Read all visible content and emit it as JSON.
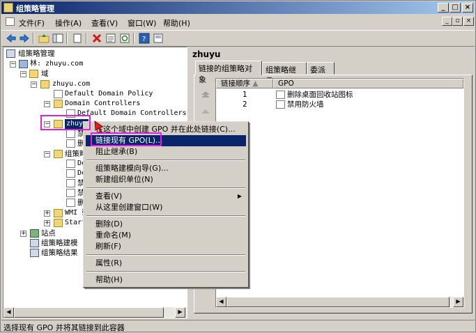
{
  "window": {
    "title": "组策略管理",
    "controls": [
      "_",
      "□",
      "×"
    ]
  },
  "menubar": {
    "items": [
      {
        "label": "文件(F)"
      },
      {
        "label": "操作(A)"
      },
      {
        "label": "查看(V)"
      },
      {
        "label": "窗口(W)"
      },
      {
        "label": "帮助(H)"
      }
    ],
    "mdi_controls": [
      "_",
      "▫",
      "×"
    ]
  },
  "toolbar": {
    "buttons": [
      "back-icon",
      "forward-icon",
      "up-folder-icon",
      "show-hide-tree-icon",
      "new-window-icon",
      "delete-icon",
      "properties-icon",
      "refresh-icon",
      "help-icon",
      "view-icon"
    ]
  },
  "tree": {
    "root": "组策略管理",
    "forest": "林: zhuyu.com",
    "domains": "域",
    "domain": "zhuyu.com",
    "default_policy": "Default Domain Policy",
    "dc_ou": "Domain Controllers",
    "default_dc_policy": "Default Domain Controllers Po",
    "selected_ou": "zhuyu",
    "child1": "禁",
    "child2": "删",
    "gpo_container": "组策略",
    "gpo1": "De",
    "gpo2": "De",
    "gpo3": "禁",
    "gpo4": "禁",
    "gpo5": "删",
    "wmi": "WMI 筛",
    "starter": "Start",
    "sites": "站点",
    "modeling": "组策略建模",
    "results": "组策略结果"
  },
  "right": {
    "title": "zhuyu",
    "tabs": [
      {
        "label": "链接的组策略对象"
      },
      {
        "label": "组策略继承"
      },
      {
        "label": "委派"
      }
    ],
    "columns": {
      "order": "链接顺序",
      "gpo": "GPO"
    },
    "rows": [
      {
        "order": "1",
        "gpo": "删除桌面回收站图标"
      },
      {
        "order": "2",
        "gpo": "禁用防火墙"
      }
    ]
  },
  "context_menu": {
    "items": [
      {
        "label": "在这个域中创建 GPO 并在此处链接(C)..."
      },
      {
        "label": "链接现有 GPO(L)..."
      },
      {
        "label": "阻止继承(B)"
      },
      {
        "label": "组策略建模向导(G)..."
      },
      {
        "label": "新建组织单位(N)"
      },
      {
        "label": "查看(V)"
      },
      {
        "label": "从这里创建窗口(W)"
      },
      {
        "label": "删除(D)"
      },
      {
        "label": "重命名(M)"
      },
      {
        "label": "刷新(F)"
      },
      {
        "label": "属性(R)"
      },
      {
        "label": "帮助(H)"
      }
    ]
  },
  "status": {
    "text": "选择现有 GPO 并将其链接到此容器"
  },
  "colors": {
    "selection": "#0a246a",
    "highlight_box": "#e020e0",
    "cursor": "#e02020"
  }
}
